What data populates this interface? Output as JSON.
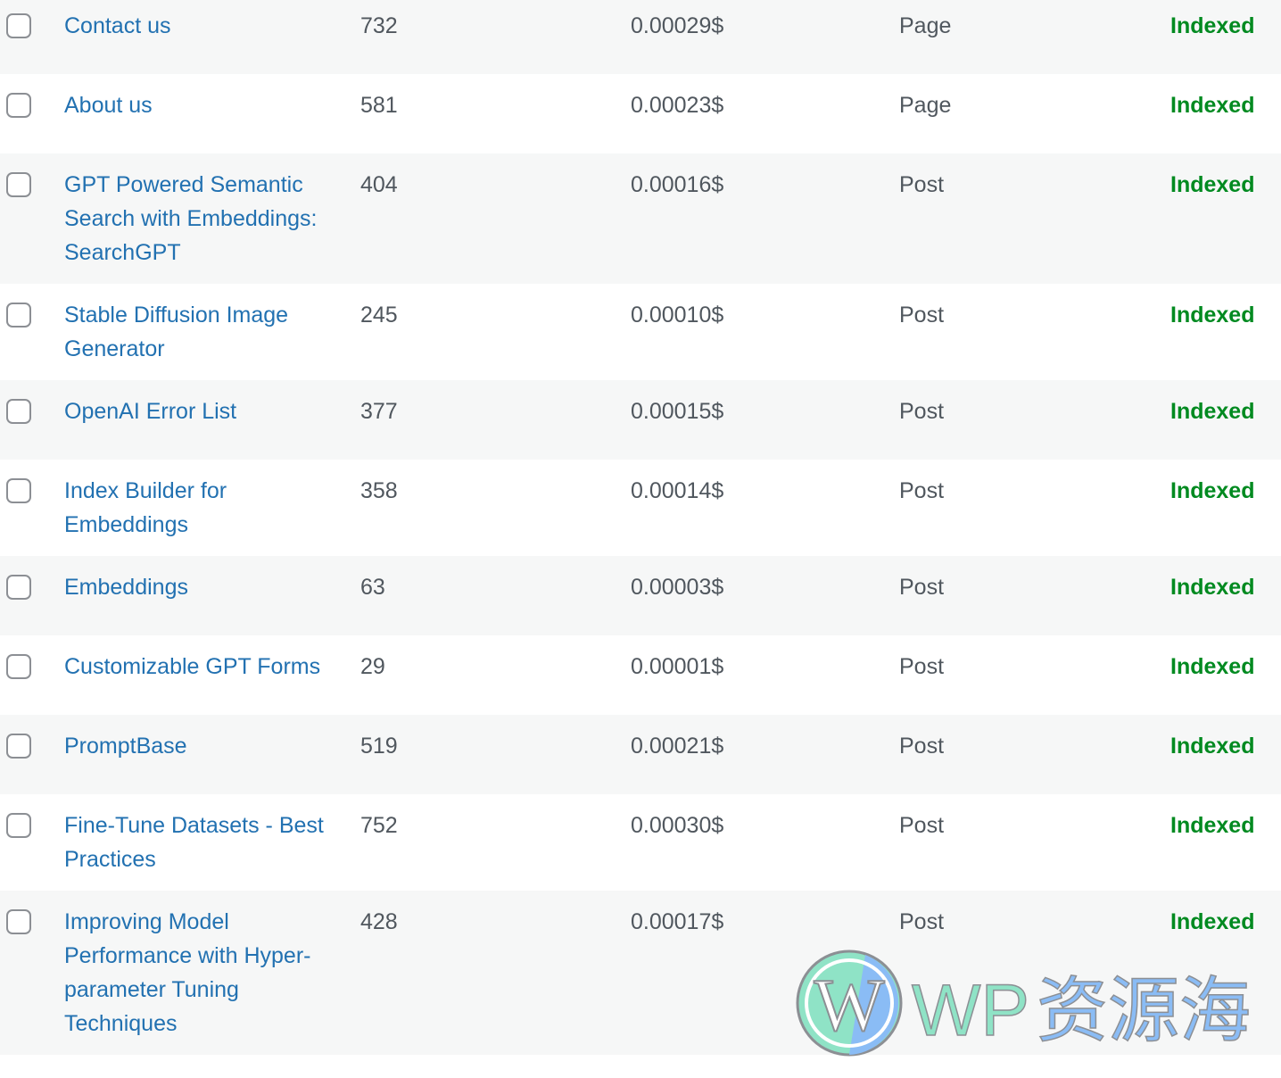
{
  "rows": [
    {
      "title": "Contact us",
      "count": "732",
      "cost": "0.00029$",
      "type": "Page",
      "status": "Indexed"
    },
    {
      "title": "About us",
      "count": "581",
      "cost": "0.00023$",
      "type": "Page",
      "status": "Indexed"
    },
    {
      "title": "GPT Powered Semantic Search with Embeddings: SearchGPT",
      "count": "404",
      "cost": "0.00016$",
      "type": "Post",
      "status": "Indexed"
    },
    {
      "title": "Stable Diffusion Image Generator",
      "count": "245",
      "cost": "0.00010$",
      "type": "Post",
      "status": "Indexed"
    },
    {
      "title": "OpenAI Error List",
      "count": "377",
      "cost": "0.00015$",
      "type": "Post",
      "status": "Indexed"
    },
    {
      "title": "Index Builder for Embeddings",
      "count": "358",
      "cost": "0.00014$",
      "type": "Post",
      "status": "Indexed"
    },
    {
      "title": "Embeddings",
      "count": "63",
      "cost": "0.00003$",
      "type": "Post",
      "status": "Indexed"
    },
    {
      "title": "Customizable GPT Forms",
      "count": "29",
      "cost": "0.00001$",
      "type": "Post",
      "status": "Indexed"
    },
    {
      "title": "PromptBase",
      "count": "519",
      "cost": "0.00021$",
      "type": "Post",
      "status": "Indexed"
    },
    {
      "title": "Fine-Tune Datasets - Best Practices",
      "count": "752",
      "cost": "0.00030$",
      "type": "Post",
      "status": "Indexed"
    },
    {
      "title": "Improving Model Performance with Hyper-parameter Tuning Techniques",
      "count": "428",
      "cost": "0.00017$",
      "type": "Post",
      "status": "Indexed"
    }
  ],
  "watermark": {
    "text": "WP资源海",
    "icon": "wordpress-logo-icon"
  },
  "colors": {
    "link": "#2271b1",
    "indexed": "#008a20",
    "stripe": "#f6f7f7"
  }
}
